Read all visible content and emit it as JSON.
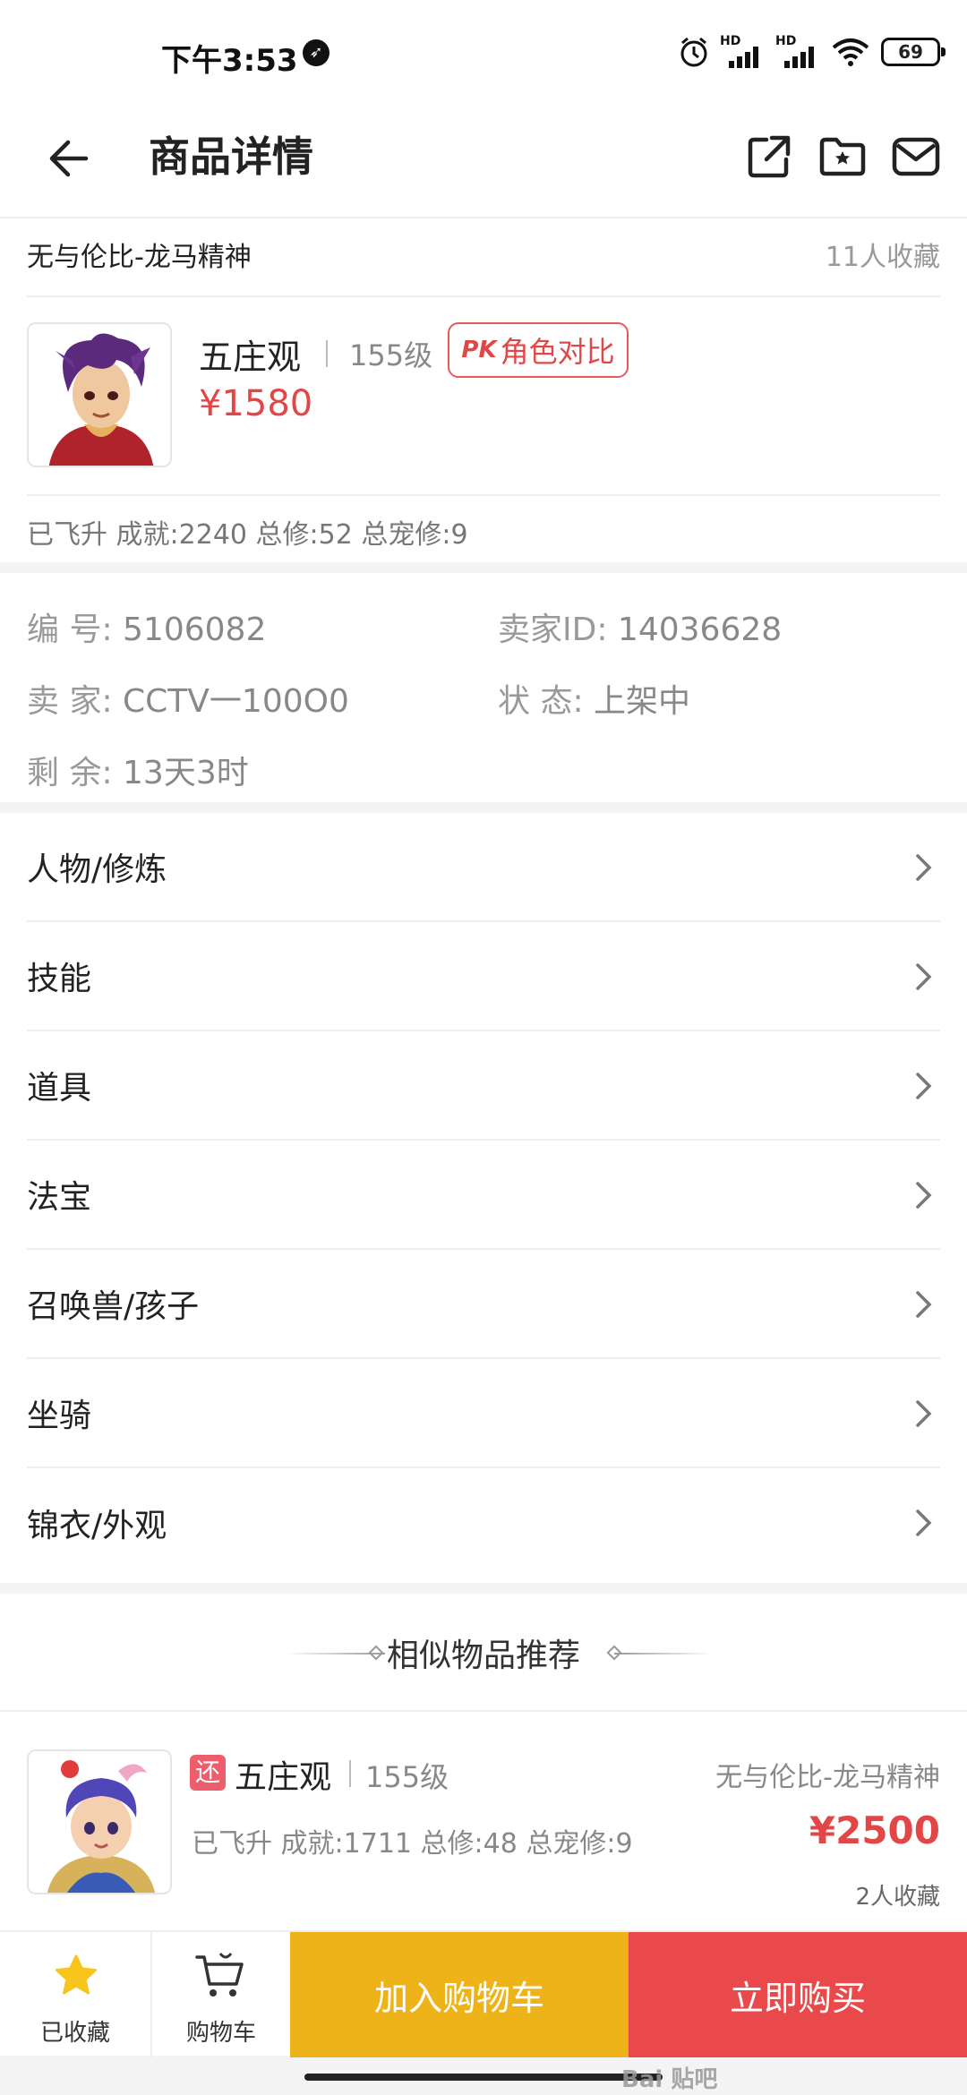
{
  "status_bar": {
    "time": "下午3:53",
    "battery": "69",
    "hd1": "HD",
    "hd2": "HD"
  },
  "header": {
    "title": "商品详情"
  },
  "product": {
    "server": "无与伦比-龙马精神",
    "fav_count": "11人收藏",
    "role": "五庄观",
    "level": "155级",
    "compare_label": "角色对比",
    "compare_mark": "PK",
    "price": "¥1580",
    "stats": "已飞升 成就:2240 总修:52 总宠修:9"
  },
  "info": {
    "id_label": "编   号: ",
    "id_value": "5106082",
    "seller_id_label": "卖家ID: ",
    "seller_id_value": "14036628",
    "seller_label": "卖   家: ",
    "seller_value": "CCTV一100O0",
    "status_label": "状   态: ",
    "status_value": "上架中",
    "remain_label": "剩   余: ",
    "remain_value": "13天3时"
  },
  "menu": [
    {
      "label": "人物/修炼"
    },
    {
      "label": "技能"
    },
    {
      "label": "道具"
    },
    {
      "label": "法宝"
    },
    {
      "label": "召唤兽/孩子"
    },
    {
      "label": "坐骑"
    },
    {
      "label": "锦衣/外观"
    }
  ],
  "recommend": {
    "title": "相似物品推荐",
    "item": {
      "tag": "还",
      "role": "五庄观",
      "level": "155级",
      "server": "无与伦比-龙马精神",
      "stats": "已飞升 成就:1711 总修:48 总宠修:9",
      "price": "¥2500",
      "fav": "2人收藏"
    }
  },
  "bottom": {
    "fav_label": "已收藏",
    "cart_label": "购物车",
    "add_cart": "加入购物车",
    "buy_now": "立即购买"
  },
  "watermark": "Bai 贴吧",
  "colors": {
    "price_red": "#e24646",
    "cart_yellow": "#efb31a",
    "buy_red": "#e9494b",
    "star": "#f7c51b"
  }
}
